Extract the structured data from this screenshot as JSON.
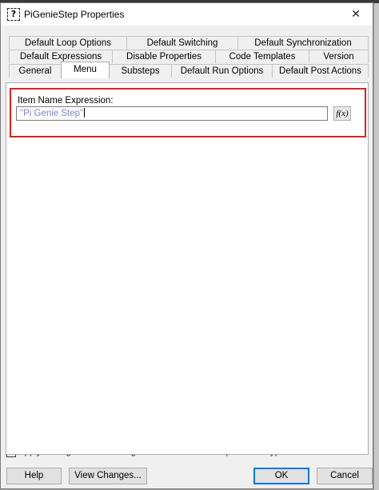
{
  "window": {
    "title": "PiGenieStep Properties",
    "app_icon_glyph": "?",
    "close_glyph": "✕"
  },
  "tabs": {
    "row1": [
      {
        "label": "Default Loop Options"
      },
      {
        "label": "Default Switching"
      },
      {
        "label": "Default Synchronization"
      }
    ],
    "row2": [
      {
        "label": "Default Expressions"
      },
      {
        "label": "Disable Properties"
      },
      {
        "label": "Code Templates"
      },
      {
        "label": "Version"
      }
    ],
    "row3": [
      {
        "label": "General"
      },
      {
        "label": "Menu"
      },
      {
        "label": "Substeps"
      },
      {
        "label": "Default Run Options"
      },
      {
        "label": "Default Post Actions"
      }
    ],
    "active": "Menu"
  },
  "menu_panel": {
    "item_name_label": "Item Name Expression:",
    "item_name_value": "\"Pi Genie Step\"",
    "fx_button_label": "f(x)"
  },
  "apply_changes": {
    "label": "Apply Changes in this Dialog Box to all Loaded Steps of this Type.",
    "checked": false
  },
  "buttons": {
    "help": "Help",
    "view_changes": "View Changes...",
    "ok": "OK",
    "cancel": "Cancel"
  },
  "colors": {
    "highlight": "#e0201f",
    "default_button_border": "#0078d7",
    "expression_text": "#7a86c9"
  }
}
